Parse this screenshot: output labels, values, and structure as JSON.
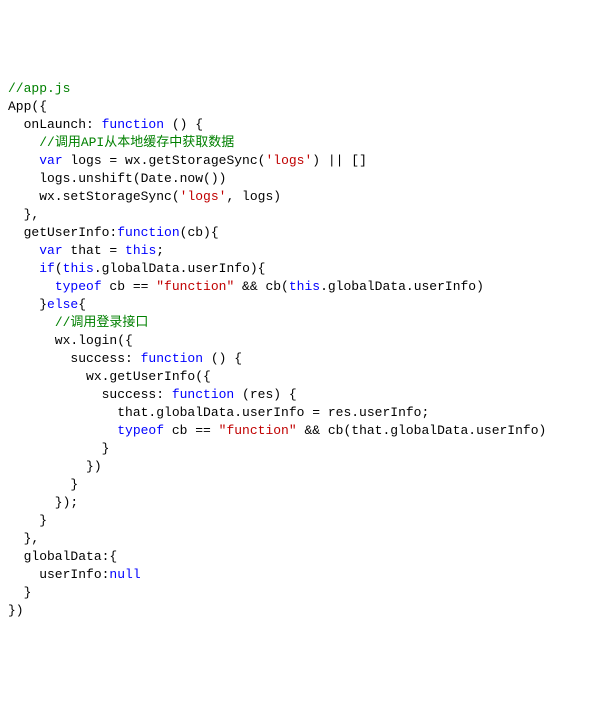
{
  "code": {
    "lines": [
      [
        {
          "t": "comment",
          "v": "//app.js"
        }
      ],
      [
        {
          "t": "identifier",
          "v": "App({"
        }
      ],
      [
        {
          "t": "identifier",
          "v": "  onLaunch: "
        },
        {
          "t": "keyword",
          "v": "function"
        },
        {
          "t": "identifier",
          "v": " () {"
        }
      ],
      [
        {
          "t": "identifier",
          "v": "    "
        },
        {
          "t": "comment",
          "v": "//调用API从本地缓存中获取数据"
        }
      ],
      [
        {
          "t": "identifier",
          "v": "    "
        },
        {
          "t": "keyword",
          "v": "var"
        },
        {
          "t": "identifier",
          "v": " logs = wx.getStorageSync("
        },
        {
          "t": "string",
          "v": "'logs'"
        },
        {
          "t": "identifier",
          "v": ") || []"
        }
      ],
      [
        {
          "t": "identifier",
          "v": "    logs.unshift(Date.now())"
        }
      ],
      [
        {
          "t": "identifier",
          "v": "    wx.setStorageSync("
        },
        {
          "t": "string",
          "v": "'logs'"
        },
        {
          "t": "identifier",
          "v": ", logs)"
        }
      ],
      [
        {
          "t": "identifier",
          "v": "  },"
        }
      ],
      [
        {
          "t": "identifier",
          "v": "  getUserInfo:"
        },
        {
          "t": "keyword",
          "v": "function"
        },
        {
          "t": "identifier",
          "v": "(cb){"
        }
      ],
      [
        {
          "t": "identifier",
          "v": "    "
        },
        {
          "t": "keyword",
          "v": "var"
        },
        {
          "t": "identifier",
          "v": " that = "
        },
        {
          "t": "keyword",
          "v": "this"
        },
        {
          "t": "identifier",
          "v": ";"
        }
      ],
      [
        {
          "t": "identifier",
          "v": "    "
        },
        {
          "t": "keyword",
          "v": "if"
        },
        {
          "t": "identifier",
          "v": "("
        },
        {
          "t": "keyword",
          "v": "this"
        },
        {
          "t": "identifier",
          "v": ".globalData.userInfo){"
        }
      ],
      [
        {
          "t": "identifier",
          "v": "      "
        },
        {
          "t": "keyword",
          "v": "typeof"
        },
        {
          "t": "identifier",
          "v": " cb == "
        },
        {
          "t": "string",
          "v": "\"function\""
        },
        {
          "t": "identifier",
          "v": " && cb("
        },
        {
          "t": "keyword",
          "v": "this"
        },
        {
          "t": "identifier",
          "v": ".globalData.userInfo)"
        }
      ],
      [
        {
          "t": "identifier",
          "v": "    }"
        },
        {
          "t": "keyword",
          "v": "else"
        },
        {
          "t": "identifier",
          "v": "{"
        }
      ],
      [
        {
          "t": "identifier",
          "v": "      "
        },
        {
          "t": "comment",
          "v": "//调用登录接口"
        }
      ],
      [
        {
          "t": "identifier",
          "v": "      wx.login({"
        }
      ],
      [
        {
          "t": "identifier",
          "v": "        success: "
        },
        {
          "t": "keyword",
          "v": "function"
        },
        {
          "t": "identifier",
          "v": " () {"
        }
      ],
      [
        {
          "t": "identifier",
          "v": "          wx.getUserInfo({"
        }
      ],
      [
        {
          "t": "identifier",
          "v": "            success: "
        },
        {
          "t": "keyword",
          "v": "function"
        },
        {
          "t": "identifier",
          "v": " (res) {"
        }
      ],
      [
        {
          "t": "identifier",
          "v": "              that.globalData.userInfo = res.userInfo;"
        }
      ],
      [
        {
          "t": "identifier",
          "v": "              "
        },
        {
          "t": "keyword",
          "v": "typeof"
        },
        {
          "t": "identifier",
          "v": " cb == "
        },
        {
          "t": "string",
          "v": "\"function\""
        },
        {
          "t": "identifier",
          "v": " && cb(that.globalData.userInfo)"
        }
      ],
      [
        {
          "t": "identifier",
          "v": "            }"
        }
      ],
      [
        {
          "t": "identifier",
          "v": "          })"
        }
      ],
      [
        {
          "t": "identifier",
          "v": "        }"
        }
      ],
      [
        {
          "t": "identifier",
          "v": "      });"
        }
      ],
      [
        {
          "t": "identifier",
          "v": "    }"
        }
      ],
      [
        {
          "t": "identifier",
          "v": "  },"
        }
      ],
      [
        {
          "t": "identifier",
          "v": "  globalData:{"
        }
      ],
      [
        {
          "t": "identifier",
          "v": "    userInfo:"
        },
        {
          "t": "literal",
          "v": "null"
        }
      ],
      [
        {
          "t": "identifier",
          "v": "  }"
        }
      ],
      [
        {
          "t": "identifier",
          "v": "})"
        }
      ]
    ]
  }
}
